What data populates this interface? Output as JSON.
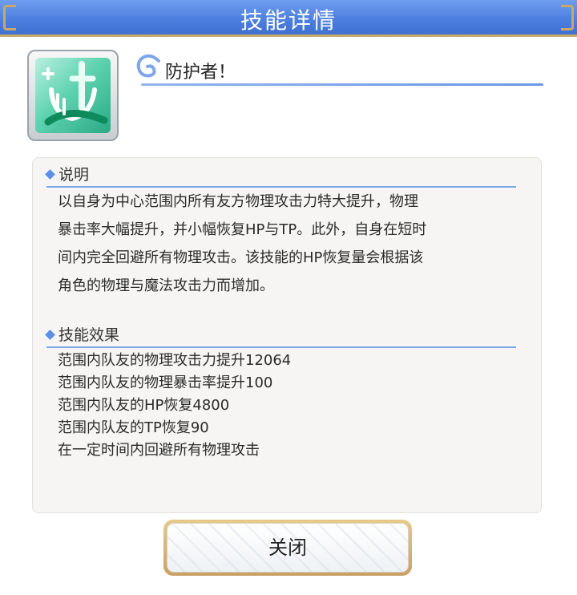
{
  "dialog": {
    "title": "技能详情",
    "close_label": "关闭"
  },
  "skill": {
    "name": "防护者！",
    "icon": "skill-icon-green-guard",
    "description_heading": "说明",
    "description_lines": [
      "以自身为中心范围内所有友方物理攻击力特大提升，物理",
      "暴击率大幅提升，并小幅恢复HP与TP。此外，自身在短时",
      "间内完全回避所有物理攻击。该技能的HP恢复量会根据该",
      "角色的物理与魔法攻击力而增加。"
    ],
    "effects_heading": "技能效果",
    "effects": [
      "范围内队友的物理攻击力提升12064",
      "范围内队友的物理暴击率提升100",
      "范围内队友的HP恢复4800",
      "范围内队友的TP恢复90",
      "在一定时间内回避所有物理攻击"
    ]
  },
  "colors": {
    "header": "#4d80e0",
    "accent": "#5a90e6",
    "gold_border": "#c9a86a"
  }
}
